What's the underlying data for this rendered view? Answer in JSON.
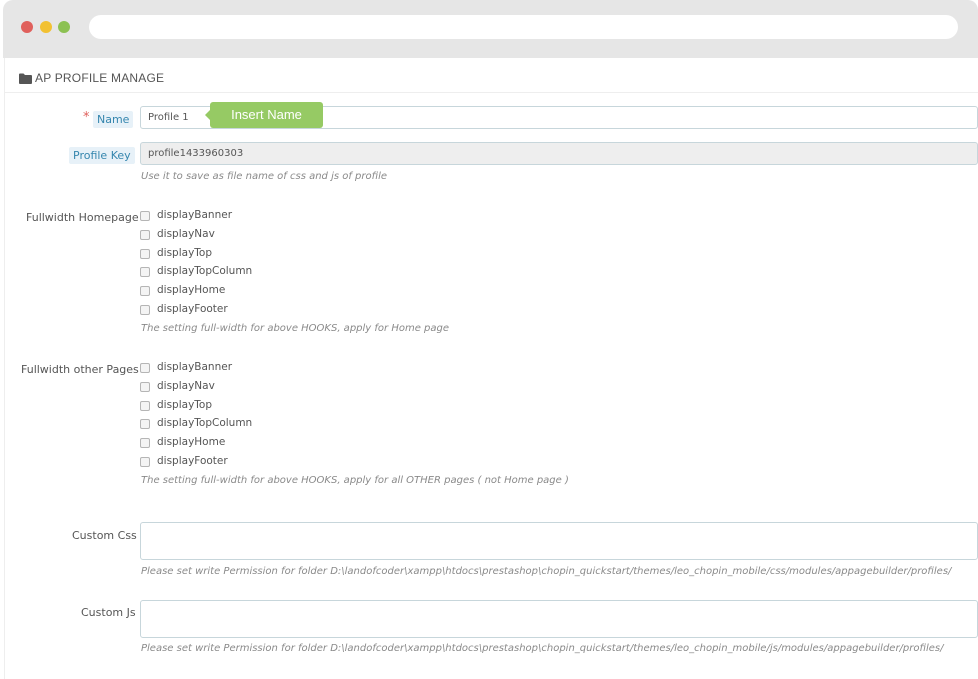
{
  "window": {
    "controls": [
      "close",
      "minimize",
      "maximize"
    ]
  },
  "panel": {
    "title": "AP PROFILE MANAGE",
    "icon": "folder-icon"
  },
  "form": {
    "name": {
      "required_mark": "*",
      "label": "Name",
      "value": "Profile 1",
      "tooltip": "Insert Name"
    },
    "profile_key": {
      "label": "Profile Key",
      "value": "profile1433960303",
      "help": "Use it to save as file name of css and js of profile"
    },
    "fullwidth_homepage": {
      "label": "Fullwidth Homepage",
      "options": [
        "displayBanner",
        "displayNav",
        "displayTop",
        "displayTopColumn",
        "displayHome",
        "displayFooter"
      ],
      "help": "The setting full-width for above HOOKS, apply for Home page"
    },
    "fullwidth_other": {
      "label": "Fullwidth other Pages",
      "options": [
        "displayBanner",
        "displayNav",
        "displayTop",
        "displayTopColumn",
        "displayHome",
        "displayFooter"
      ],
      "help": "The setting full-width for above HOOKS, apply for all OTHER pages ( not Home page )"
    },
    "custom_css": {
      "label": "Custom Css",
      "value": "",
      "help": "Please set write Permission for folder D:\\landofcoder\\xampp\\htdocs\\prestashop\\chopin_quickstart/themes/leo_chopin_mobile/css/modules/appagebuilder/profiles/"
    },
    "custom_js": {
      "label": "Custom Js",
      "value": "",
      "help": "Please set write Permission for folder D:\\landofcoder\\xampp\\htdocs\\prestashop\\chopin_quickstart/themes/leo_chopin_mobile/js/modules/appagebuilder/profiles/"
    }
  },
  "colors": {
    "tooltip": "#96ca64",
    "label_highlight": "#e7f1f8",
    "label_text": "#3586ae",
    "required": "#e0605c"
  }
}
